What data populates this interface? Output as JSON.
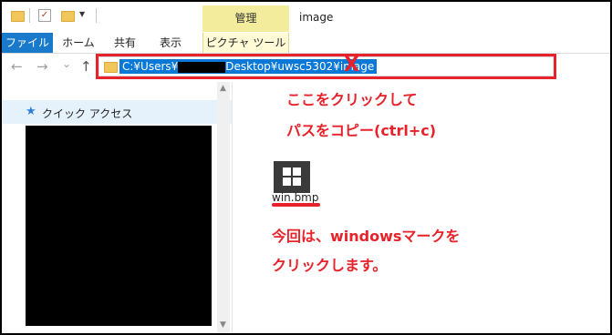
{
  "title_bar": {
    "manage_tab": "管理",
    "window_title": "image",
    "dropdown_glyph": "▾"
  },
  "ribbon": {
    "tabs": [
      "ファイル",
      "ホーム",
      "共有",
      "表示",
      "ピクチャ ツール"
    ]
  },
  "nav": {
    "back_glyph": "←",
    "forward_glyph": "→",
    "recent_glyph": "⌄",
    "up_glyph": "↑"
  },
  "address": {
    "path_prefix": "C:¥Users¥",
    "path_suffix": "Desktop¥uwsc5302¥image",
    "x_mark": "X"
  },
  "left_pane": {
    "quick_access_label": "クイック アクセス",
    "star_glyph": "★"
  },
  "main": {
    "file_name": "win.bmp"
  },
  "annotations": {
    "line1": "ここをクリックして",
    "line2": "パスをコピー(ctrl+c)",
    "line3": "今回は、windowsマークを",
    "line4": "クリックします。"
  },
  "colors": {
    "accent_file_tab": "#1979ca",
    "manage_tab": "#f2ec9c",
    "annotation_red": "#e8222a",
    "selection_blue": "#0a78d7"
  },
  "icons": [
    "folder-icon",
    "checklist-icon",
    "back-arrow-icon",
    "forward-arrow-icon",
    "up-arrow-icon",
    "star-icon",
    "windows-logo-icon"
  ]
}
